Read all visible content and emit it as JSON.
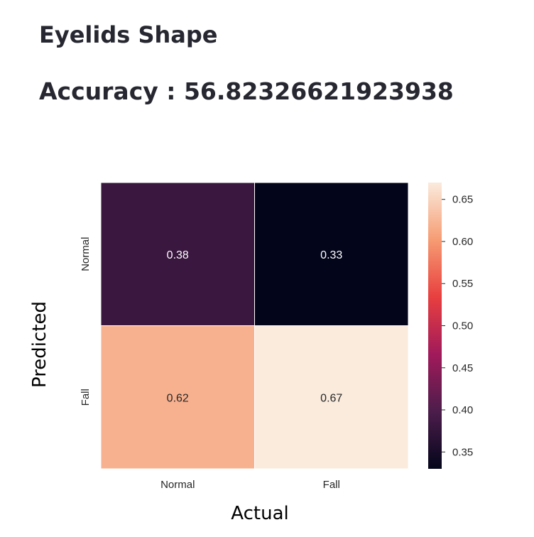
{
  "page": {
    "title": "Eyelids Shape",
    "accuracy_text": "Accuracy : 56.82326621923938"
  },
  "chart_data": {
    "type": "heatmap",
    "xlabel": "Actual",
    "ylabel": "Predicted",
    "x_categories": [
      "Normal",
      "Fall"
    ],
    "y_categories": [
      "Normal",
      "Fall"
    ],
    "values": [
      [
        0.38,
        0.33
      ],
      [
        0.62,
        0.67
      ]
    ],
    "annotations": [
      [
        "0.38",
        "0.33"
      ],
      [
        "0.62",
        "0.67"
      ]
    ],
    "colorbar": {
      "range": [
        0.33,
        0.67
      ],
      "ticks": [
        0.35,
        0.4,
        0.45,
        0.5,
        0.55,
        0.6,
        0.65
      ],
      "tick_labels": [
        "0.35",
        "0.40",
        "0.45",
        "0.50",
        "0.55",
        "0.60",
        "0.65"
      ],
      "colormap": [
        "#03051a",
        "#4c1d4b",
        "#a11a5b",
        "#e83f3f",
        "#f69c73",
        "#faebdd"
      ]
    }
  }
}
